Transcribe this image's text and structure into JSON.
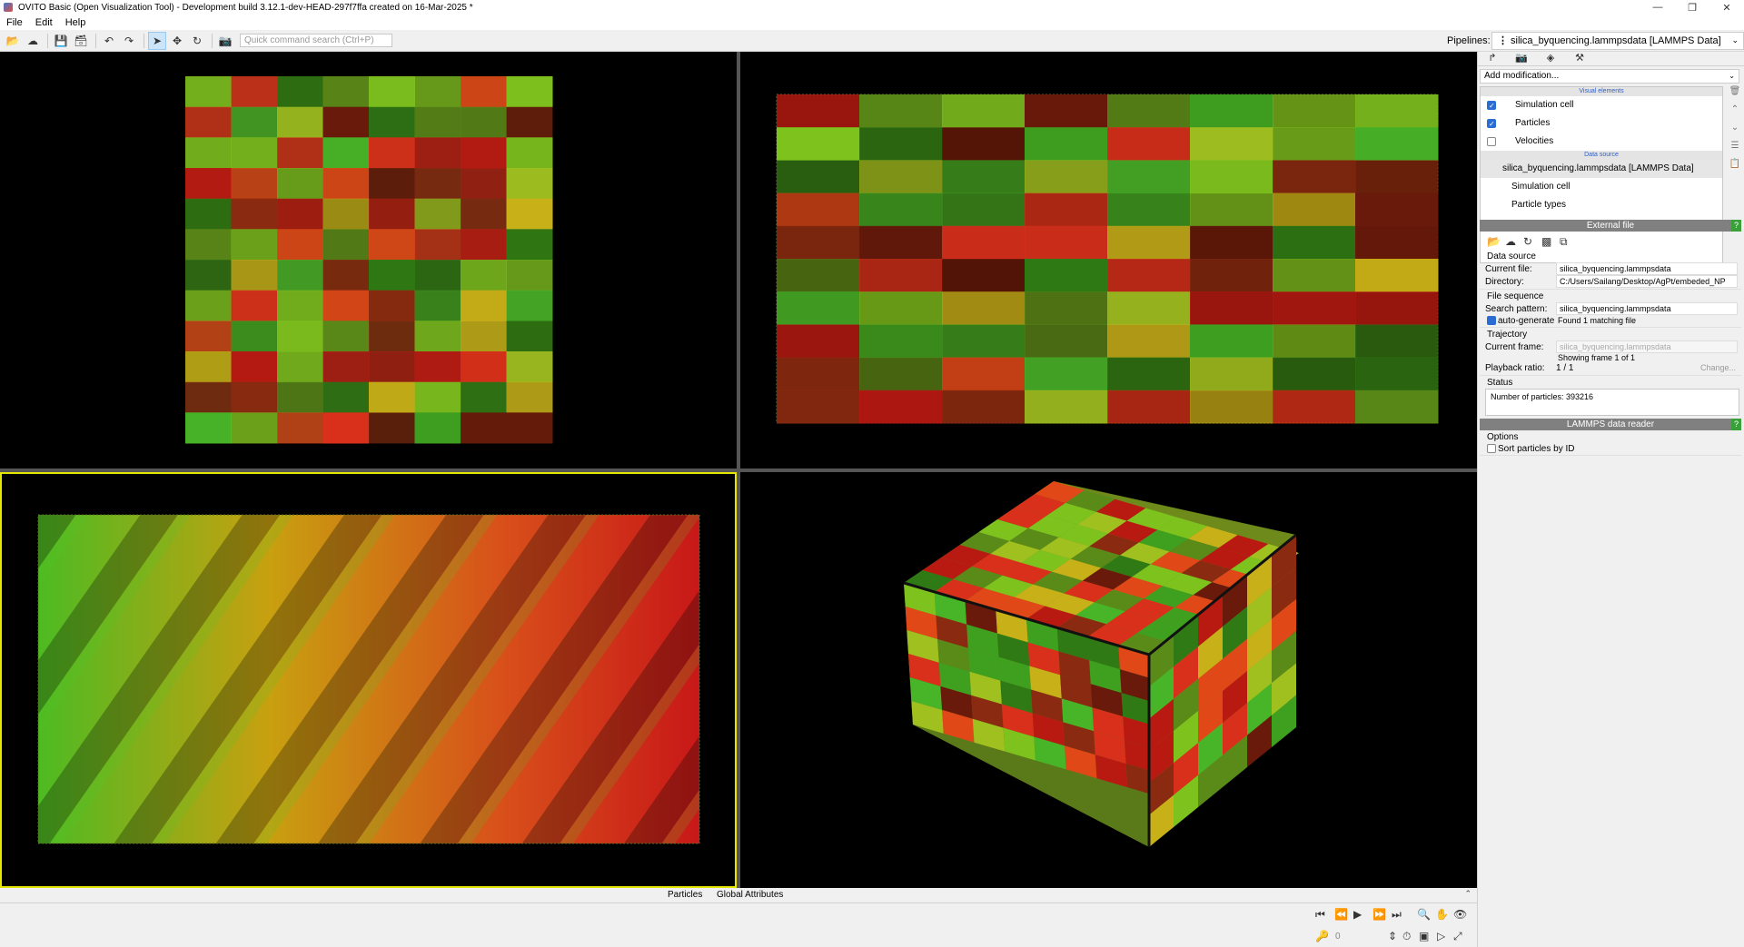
{
  "window": {
    "title": "OVITO Basic (Open Visualization Tool) - Development build 3.12.1-dev-HEAD-297f7ffa created on 16-Mar-2025 *",
    "controls": [
      "—",
      "❐",
      "✕"
    ]
  },
  "menu": [
    "File",
    "Edit",
    "Help"
  ],
  "toolbar": {
    "search_placeholder": "Quick command search (Ctrl+P)",
    "pipelines_label": "Pipelines:",
    "pipeline_selected": "silica_byquencing.lammpsdata [LAMMPS Data]"
  },
  "side": {
    "add_modification": "Add modification...",
    "visual_elements_header": "Visual elements",
    "visual_elements": [
      {
        "label": "Simulation cell",
        "checked": true
      },
      {
        "label": "Particles",
        "checked": true
      },
      {
        "label": "Velocities",
        "checked": false
      }
    ],
    "data_source_header": "Data source",
    "data_source_item": "silica_byquencing.lammpsdata [LAMMPS Data]",
    "data_source_children": [
      "Simulation cell",
      "Particle types"
    ],
    "external_file": {
      "header": "External file",
      "help": "?",
      "data_source_group": "Data source",
      "current_file_label": "Current file:",
      "current_file": "silica_byquencing.lammpsdata",
      "directory_label": "Directory:",
      "directory": "C:/Users/Sailang/Desktop/AgPt/embeded_NP",
      "file_sequence_group": "File sequence",
      "search_pattern_label": "Search pattern:",
      "search_pattern": "silica_byquencing.lammpsdata",
      "auto_generate_label": "auto-generate",
      "found_text": "Found 1 matching file",
      "trajectory_group": "Trajectory",
      "current_frame_label": "Current frame:",
      "current_frame": "silica_byquencing.lammpsdata",
      "showing_frame": "Showing frame 1 of 1",
      "playback_ratio_label": "Playback ratio:",
      "playback_ratio": "1 / 1",
      "change_button": "Change...",
      "status_group": "Status",
      "status_text": "Number of particles: 393216"
    },
    "reader": {
      "header": "LAMMPS data reader",
      "help": "?",
      "options_group": "Options",
      "sort_label": "Sort particles by ID"
    }
  },
  "bottom_tabs": [
    "Particles",
    "Global Attributes"
  ],
  "animation": {
    "frame": "0"
  },
  "colors": {
    "selected_viewport_border": "#e6e600",
    "checkbox_blue": "#2b6cd4",
    "panel_header": "#808080",
    "help_green": "#3aa03a"
  }
}
